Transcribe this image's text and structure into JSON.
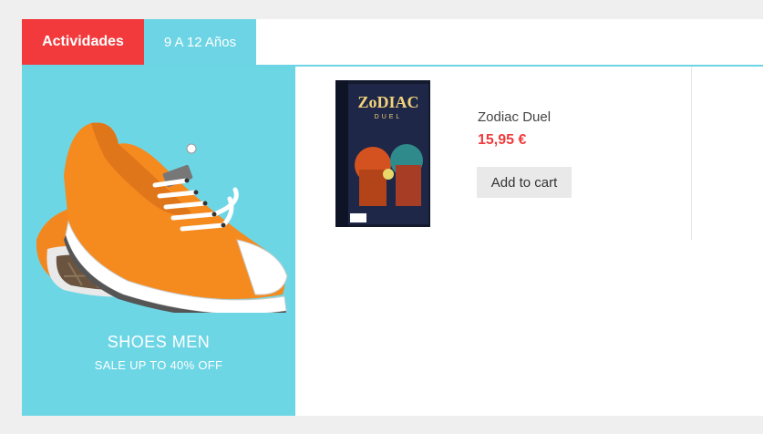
{
  "tabs": {
    "active_label": "Actividades",
    "second_label": "9 A 12 Años"
  },
  "banner": {
    "title": "SHOES MEN",
    "subtitle": "SALE UP TO 40% OFF"
  },
  "product": {
    "name": "Zodiac Duel",
    "price": "15,95 €",
    "add_to_cart_label": "Add to cart",
    "box_title": "ZoDIAC",
    "box_subtitle": "DUEL"
  },
  "colors": {
    "accent_red": "#f23a3c",
    "accent_cyan": "#6cd4e4"
  }
}
